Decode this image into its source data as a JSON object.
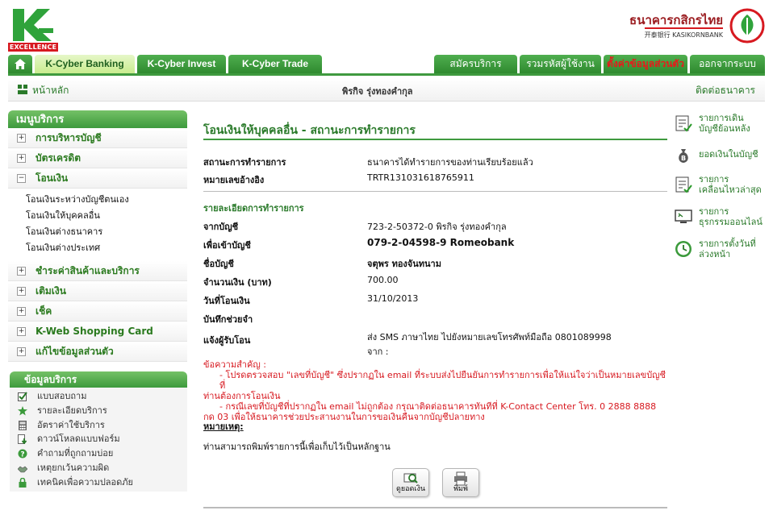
{
  "header": {
    "brand_badge": "EXCELLENCE",
    "bank_name_th": "ธนาคารกสิกรไทย",
    "bank_name_en": "开泰银行 KASIKORNBANK"
  },
  "tabs": {
    "left": [
      "K-Cyber Banking",
      "K-Cyber Invest",
      "K-Cyber Trade"
    ],
    "right": [
      "สมัครบริการ",
      "รวมรหัสผู้ใช้งาน",
      "ตั้งค่าข้อมูลส่วนตัว",
      "ออกจากระบบ"
    ]
  },
  "subheader": {
    "home": "หน้าหลัก",
    "user": "พิรกิจ รุ่งทองคำกุล",
    "contact": "ติดต่อธนาคาร"
  },
  "menu": {
    "title": "เมนูบริการ",
    "items_top": [
      {
        "label": "การบริหารบัญชี",
        "sign": "+"
      },
      {
        "label": "บัตรเครดิต",
        "sign": "+"
      },
      {
        "label": "โอนเงิน",
        "sign": "−"
      }
    ],
    "sub_items": [
      "โอนเงินระหว่างบัญชีตนเอง",
      "โอนเงินให้บุคคลอื่น",
      "โอนเงินต่างธนาคาร",
      "โอนเงินต่างประเทศ"
    ],
    "items_bottom": [
      {
        "label": "ชำระค่าสินค้าและบริการ",
        "sign": "+"
      },
      {
        "label": "เติมเงิน",
        "sign": "+"
      },
      {
        "label": "เช็ค",
        "sign": "+"
      },
      {
        "label": "K-Web Shopping Card",
        "sign": "+"
      },
      {
        "label": "แก้ไขข้อมูลส่วนตัว",
        "sign": "+"
      }
    ]
  },
  "info": {
    "title": "ข้อมูลบริการ",
    "items": [
      "แบบสอบถาม",
      "รายละเอียดบริการ",
      "อัตราค่าใช้บริการ",
      "ดาวน์โหลดแบบฟอร์ม",
      "คำถามที่ถูกถามบ่อย",
      "เหตุยกเว้นความผิด",
      "เทคนิคเพื่อความปลอดภัย"
    ]
  },
  "main": {
    "title": "โอนเงินให้บุคคลอื่น - สถานะการทำรายการ",
    "status_label": "สถานะการทำรายการ",
    "status_value": "ธนาคารได้ทำรายการของท่านเรียบร้อยแล้ว",
    "ref_label": "หมายเลขอ้างอิง",
    "ref_value": "TRTR131031618765911",
    "details_title": "รายละเอียดการทำรายการ",
    "from_label": "จากบัญชี",
    "from_value": "723-2-50372-0 พิรกิจ รุ่งทองคำกุล",
    "to_label": "เพื่อเข้าบัญชี",
    "to_value": "079-2-04598-9 Romeobank",
    "name_label": "ชื่อบัญชี",
    "name_value": "จตุพร ทองจันทนาม",
    "amount_label": "จำนวนเงิน (บาท)",
    "amount_value": "700.00",
    "date_label": "วันที่โอนเงิน",
    "date_value": "31/10/2013",
    "memo_label": "บันทึกช่วยจำ",
    "notify_label": "แจ้งผู้รับโอน",
    "notify_value_1": "ส่ง SMS ภาษาไทย ไปยังหมายเลขโทรศัพท์มือถือ 0801089998",
    "notify_value_2": "จาก :",
    "warn_title": "ข้อความสำคัญ :",
    "warn_line1": "- โปรดตรวจสอบ \"เลขที่บัญชี\" ซึ่งปรากฏใน email ที่ระบบส่งไปยืนยันการทำรายการเพื่อให้แน่ใจว่าเป็นหมายเลขบัญชีที่",
    "warn_line1b": "ท่านต้องการโอนเงิน",
    "warn_line2": "- กรณีเลขที่บัญชีที่ปรากฏใน email ไม่ถูกต้อง กรุณาติดต่อธนาคารทันทีที่ K-Contact Center โทร. 0 2888 8888",
    "warn_line2b": "กด 03 เพื่อให้ธนาคารช่วยประสานงานในการขอเงินคืนจากบัญชีปลายทาง",
    "note_title": "หมายเหตุ:",
    "note_body": "ท่านสามารถพิมพ์รายการนี้เพื่อเก็บไว้เป็นหลักฐาน",
    "btn_view": "ดูยอดเงิน",
    "btn_print": "พิมพ์"
  },
  "shortcuts": [
    {
      "line1": "รายการเดิน",
      "line2": "บัญชีย้อนหลัง"
    },
    {
      "line1": "ยอดเงินในบัญชี",
      "line2": ""
    },
    {
      "line1": "รายการ",
      "line2": "เคลื่อนไหวล่าสุด"
    },
    {
      "line1": "รายการ",
      "line2": "ธุรกรรมออนไลน์"
    },
    {
      "line1": "รายการตั้งวันที่",
      "line2": "ล่วงหน้า"
    }
  ],
  "colors": {
    "brand_green": "#3f9a3f",
    "brand_red": "#d71920",
    "text_green": "#2a7a2a"
  }
}
